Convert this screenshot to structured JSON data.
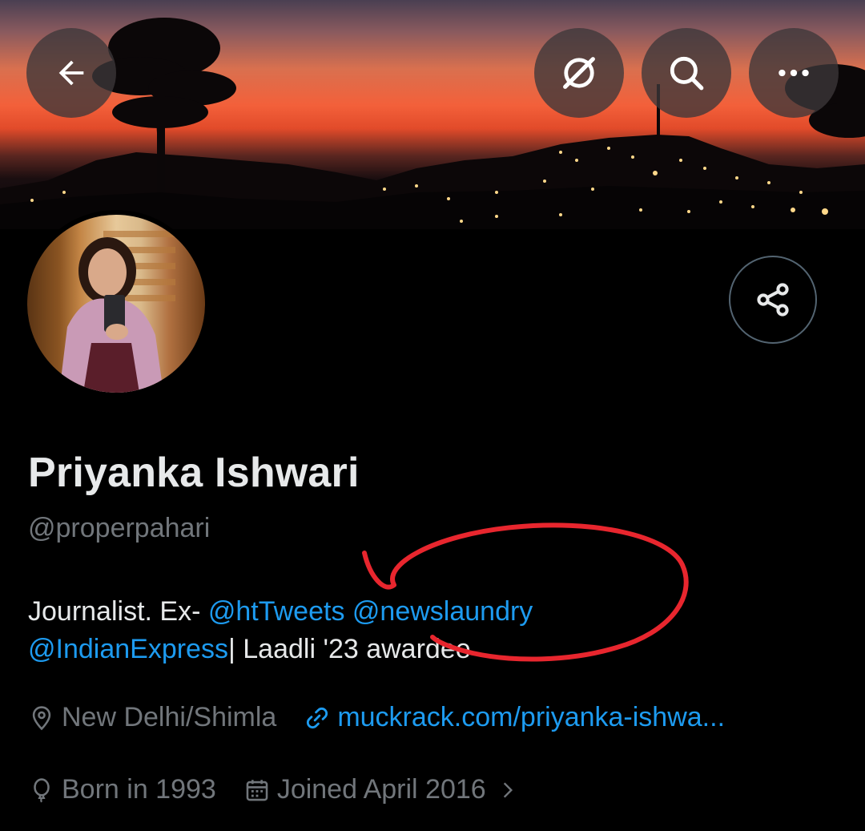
{
  "header": {
    "back_icon": "arrow-left-icon",
    "grok_icon": "grok-slash-circle-icon",
    "search_icon": "search-icon",
    "more_icon": "more-horizontal-icon"
  },
  "profile": {
    "name": "Priyanka Ishwari",
    "handle": "@properpahari",
    "bio": {
      "prefix": "Journalist. Ex- ",
      "mention_1": "@htTweets",
      "mention_2": "@newslaundry",
      "mention_3": "@IndianExpress",
      "suffix": "| Laadli '23 awardee"
    },
    "location": "New Delhi/Shimla",
    "website": "muckrack.com/priyanka-ishwa...",
    "birth": "Born in 1993",
    "joined": "Joined April 2016",
    "share_icon": "share-icon"
  },
  "colors": {
    "background": "#000000",
    "text_primary": "#e7e9ea",
    "text_secondary": "#71767b",
    "link": "#1d9bf0",
    "annotation": "#e8262e"
  }
}
